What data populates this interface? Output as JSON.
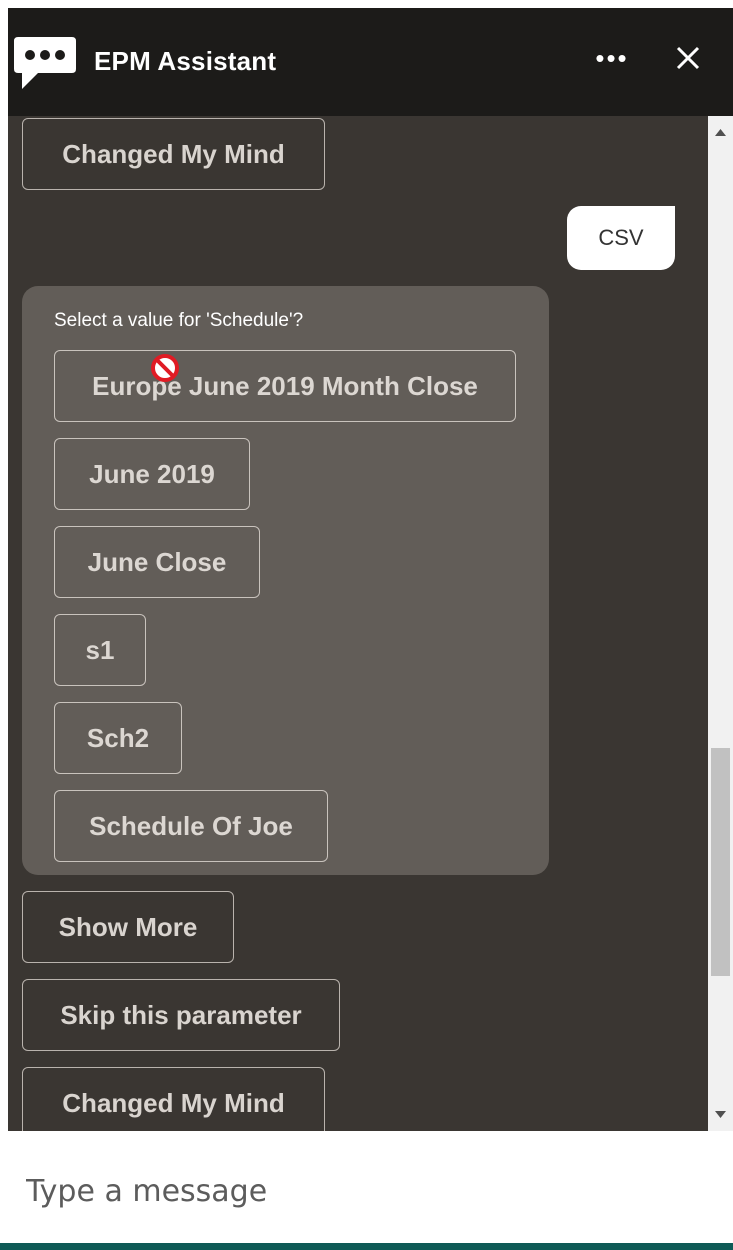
{
  "header": {
    "title": "EPM Assistant",
    "more_label": "•••",
    "icons": [
      "chat-bubble-icon",
      "more-icon",
      "close-icon"
    ]
  },
  "chat": {
    "top_action": "Changed My Mind",
    "user_message": "CSV",
    "bot_card": {
      "prompt": "Select a value for 'Schedule'?",
      "options": [
        "Europe June 2019 Month Close",
        "June 2019",
        "June Close",
        "s1",
        "Sch2",
        "Schedule Of Joe"
      ]
    },
    "actions": [
      "Show More",
      "Skip this parameter",
      "Changed My Mind"
    ]
  },
  "input": {
    "placeholder": "Type a message"
  },
  "colors": {
    "header_bg": "#1c1b19",
    "chat_bg": "#3a3632",
    "card_bg": "#625d58",
    "accent_bar": "#0e5a56"
  }
}
